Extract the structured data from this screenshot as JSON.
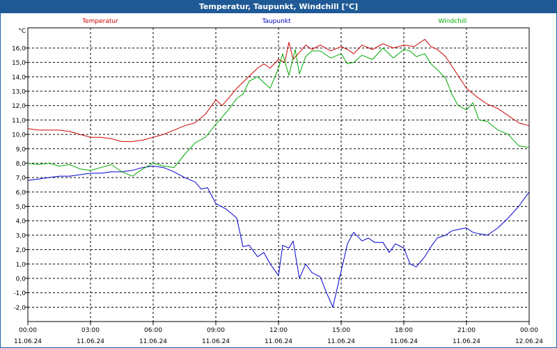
{
  "window": {
    "title": "Temperatur, Taupunkt, Windchill [°C]"
  },
  "chart_data": {
    "type": "line",
    "title": "Temperatur, Taupunkt, Windchill [°C]",
    "ylabel": "°C",
    "ylim": [
      -3,
      17.4
    ],
    "yticks": [
      -2,
      -1,
      0,
      1,
      2,
      3,
      4,
      5,
      6,
      7,
      8,
      9,
      10,
      11,
      12,
      13,
      14,
      15,
      16
    ],
    "ytick_labels": [
      "-2,0",
      "-1,0",
      "0,0",
      "1,0",
      "2,0",
      "3,0",
      "4,0",
      "5,0",
      "6,0",
      "7,0",
      "8,0",
      "9,0",
      "10,0",
      "11,0",
      "12,0",
      "13,0",
      "14,0",
      "15,0",
      "16,0"
    ],
    "xlim": [
      0,
      24
    ],
    "xticks": [
      0,
      3,
      6,
      9,
      12,
      15,
      18,
      21,
      24
    ],
    "xtick_times": [
      "00:00",
      "03:00",
      "06:00",
      "09:00",
      "12:00",
      "15:00",
      "18:00",
      "21:00",
      "00:00"
    ],
    "xtick_dates": [
      "11.06.24",
      "11.06.24",
      "11.06.24",
      "11.06.24",
      "11.06.24",
      "11.06.24",
      "11.06.24",
      "11.06.24",
      "12.06.24"
    ],
    "grid": true,
    "legend_position": "top",
    "series": [
      {
        "name": "Temperatur",
        "color": "#cc0000",
        "x": [
          0,
          0.5,
          1,
          1.5,
          2,
          2.5,
          3,
          3.5,
          4,
          4.5,
          5,
          5.5,
          6,
          6.5,
          7,
          7.5,
          8,
          8.5,
          9,
          9.3,
          9.6,
          10,
          10.5,
          11,
          11.3,
          11.6,
          12,
          12.3,
          12.5,
          12.7,
          13,
          13.3,
          13.6,
          14,
          14.5,
          15,
          15.3,
          15.6,
          16,
          16.5,
          17,
          17.5,
          18,
          18.5,
          19,
          19.3,
          19.6,
          20,
          20.5,
          21,
          21.5,
          22,
          22.5,
          23,
          23.5,
          24
        ],
        "y": [
          10.4,
          10.3,
          10.3,
          10.3,
          10.2,
          10.0,
          9.8,
          9.8,
          9.7,
          9.5,
          9.5,
          9.6,
          9.8,
          10.0,
          10.3,
          10.6,
          10.8,
          11.4,
          12.4,
          12.0,
          12.5,
          13.2,
          13.9,
          14.6,
          14.9,
          14.6,
          15.2,
          15.0,
          16.4,
          15.2,
          15.7,
          16.2,
          15.9,
          16.2,
          15.8,
          16.1,
          15.9,
          15.6,
          16.2,
          15.9,
          16.3,
          16.0,
          16.2,
          16.1,
          16.6,
          16.1,
          15.9,
          15.4,
          14.3,
          13.2,
          12.6,
          12.1,
          11.8,
          11.3,
          10.8,
          10.6
        ]
      },
      {
        "name": "Taupunkt",
        "color": "#0000cc",
        "x": [
          0,
          0.5,
          1,
          1.5,
          2,
          2.5,
          3,
          3.5,
          4,
          4.5,
          5,
          5.5,
          6,
          6.5,
          7,
          7.5,
          8,
          8.3,
          8.6,
          9,
          9.5,
          10,
          10.3,
          10.6,
          11,
          11.3,
          11.6,
          12,
          12.2,
          12.5,
          12.7,
          13,
          13.3,
          13.6,
          14,
          14.3,
          14.6,
          15,
          15.3,
          15.6,
          16,
          16.3,
          16.6,
          17,
          17.3,
          17.6,
          18,
          18.3,
          18.6,
          19,
          19.3,
          19.6,
          20,
          20.3,
          20.6,
          21,
          21.3,
          21.6,
          22,
          22.5,
          23,
          23.5,
          24
        ],
        "y": [
          6.8,
          6.9,
          7.0,
          7.1,
          7.1,
          7.2,
          7.3,
          7.3,
          7.4,
          7.4,
          7.5,
          7.7,
          7.8,
          7.7,
          7.4,
          7.0,
          6.7,
          6.2,
          6.3,
          5.2,
          4.8,
          4.2,
          2.2,
          2.3,
          1.5,
          1.8,
          1.0,
          0.2,
          2.3,
          2.1,
          2.6,
          0.0,
          1.0,
          0.4,
          0.1,
          -1.0,
          -2.0,
          0.5,
          2.4,
          3.2,
          2.6,
          2.8,
          2.5,
          2.5,
          1.8,
          2.4,
          2.1,
          1.0,
          0.8,
          1.5,
          2.2,
          2.8,
          3.0,
          3.3,
          3.4,
          3.5,
          3.2,
          3.1,
          3.0,
          3.5,
          4.2,
          5.0,
          6.0
        ]
      },
      {
        "name": "Windchill",
        "color": "#00aa00",
        "x": [
          0,
          0.5,
          1,
          1.5,
          2,
          2.5,
          3,
          3.5,
          4,
          4.5,
          5,
          5.5,
          6,
          6.5,
          7,
          7.5,
          8,
          8.5,
          9,
          9.3,
          9.6,
          10,
          10.3,
          10.6,
          11,
          11.3,
          11.6,
          12,
          12.2,
          12.5,
          12.8,
          13,
          13.3,
          13.6,
          14,
          14.5,
          15,
          15.3,
          15.6,
          16,
          16.5,
          17,
          17.5,
          18,
          18.3,
          18.6,
          19,
          19.3,
          19.6,
          20,
          20.3,
          20.6,
          21,
          21.3,
          21.6,
          22,
          22.5,
          23,
          23.5,
          24
        ],
        "y": [
          8.0,
          7.9,
          8.0,
          7.8,
          7.9,
          7.6,
          7.5,
          7.7,
          7.9,
          7.4,
          7.1,
          7.6,
          8.0,
          7.8,
          7.7,
          8.6,
          9.4,
          9.8,
          10.7,
          11.2,
          11.7,
          12.5,
          12.8,
          13.7,
          14.0,
          13.6,
          13.2,
          14.6,
          15.6,
          14.1,
          15.9,
          14.2,
          15.4,
          15.8,
          15.8,
          15.3,
          15.6,
          14.9,
          15.0,
          15.5,
          15.2,
          16.0,
          15.3,
          15.9,
          15.8,
          15.4,
          15.6,
          14.9,
          14.5,
          13.9,
          12.8,
          12.0,
          11.7,
          12.2,
          11.0,
          10.9,
          10.3,
          10.0,
          9.2,
          9.1
        ]
      }
    ]
  }
}
